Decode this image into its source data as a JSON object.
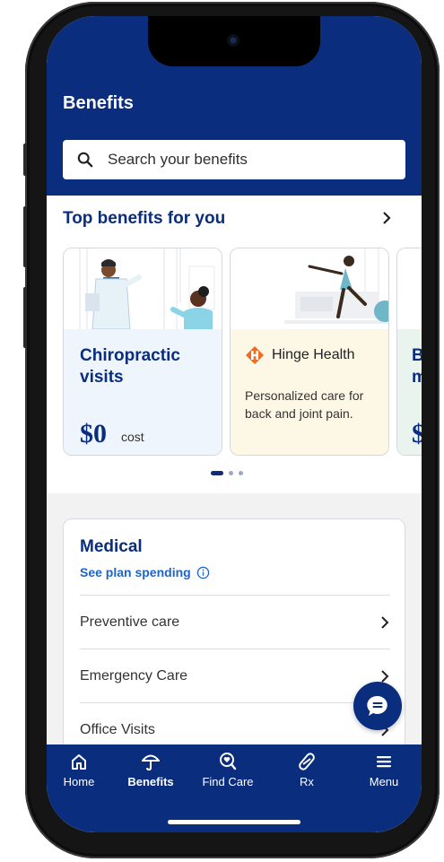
{
  "header": {
    "title": "Benefits"
  },
  "search": {
    "placeholder": "Search your benefits"
  },
  "top_benefits": {
    "title": "Top benefits for you",
    "cards": [
      {
        "title": "Chiropractic visits",
        "price": "$0",
        "price_unit": "cost"
      },
      {
        "brand": "Hinge Health",
        "description": "Personalized care for back and joint pain."
      },
      {
        "title_partial": "B\nm",
        "price_partial": "$"
      }
    ],
    "pager": {
      "count": 3,
      "active": 0
    }
  },
  "medical": {
    "title": "Medical",
    "plan_link": "See plan spending",
    "rows": [
      "Preventive care",
      "Emergency Care",
      "Office Visits"
    ]
  },
  "bottom_nav": {
    "items": [
      {
        "label": "Home",
        "icon": "home-icon"
      },
      {
        "label": "Benefits",
        "icon": "umbrella-icon",
        "active": true
      },
      {
        "label": "Find Care",
        "icon": "find-care-icon"
      },
      {
        "label": "Rx",
        "icon": "pill-icon"
      },
      {
        "label": "Menu",
        "icon": "menu-icon"
      }
    ]
  },
  "colors": {
    "brand_navy": "#0a2d7d",
    "link_blue": "#1f64c8",
    "card_blue": "#eef5fc",
    "card_yellow": "#fdf8e6",
    "hinge_orange": "#f26b21"
  }
}
